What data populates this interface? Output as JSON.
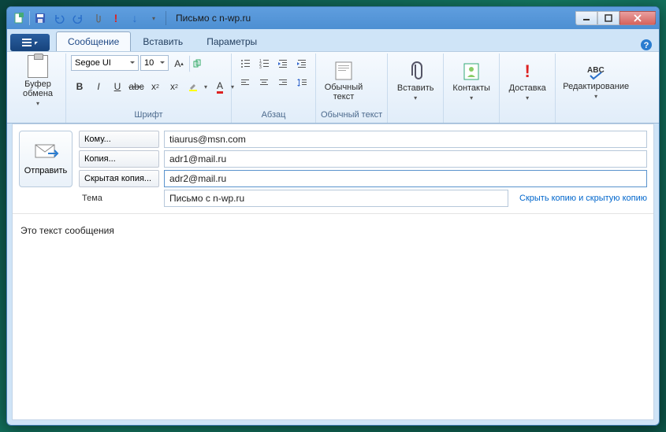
{
  "window": {
    "title": "Письмо с n-wp.ru"
  },
  "tabs": {
    "message": "Сообщение",
    "insert": "Вставить",
    "options": "Параметры"
  },
  "ribbon": {
    "clipboard": {
      "label": "Буфер обмена",
      "group": ""
    },
    "font": {
      "name": "Segoe UI",
      "size": "10",
      "group": "Шрифт"
    },
    "paragraph": {
      "group": "Абзац"
    },
    "plaintext": {
      "btn": "Обычный текст",
      "group": "Обычный текст"
    },
    "insert": "Вставить",
    "contacts": "Контакты",
    "delivery": "Доставка",
    "editing": "Редактирование"
  },
  "compose": {
    "send": "Отправить",
    "to_label": "Кому...",
    "to_value": "tiaurus@msn.com",
    "cc_label": "Копия...",
    "cc_value": "adr1@mail.ru",
    "bcc_label": "Скрытая копия...",
    "bcc_value": "adr2@mail.ru",
    "subject_label": "Тема",
    "subject_value": "Письмо с n-wp.ru",
    "hide_link": "Скрыть копию и скрытую копию",
    "body": "Это текст сообщения"
  }
}
